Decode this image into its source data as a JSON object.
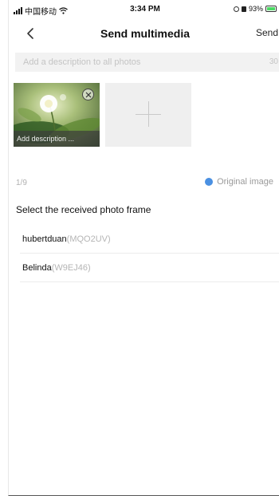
{
  "status_bar": {
    "carrier": "中国移动",
    "time": "3:34 PM",
    "battery_percent": "93%"
  },
  "nav": {
    "title": "Send multimedia",
    "send_label": "Send"
  },
  "description": {
    "placeholder": "Add a description to all photos",
    "char_limit": "30"
  },
  "photos": {
    "items": [
      {
        "caption_placeholder": "Add description ..."
      }
    ],
    "count_label": "1/9",
    "original_image_label": "Original image"
  },
  "frames": {
    "section_title": "Select the received photo frame",
    "items": [
      {
        "name": "hubertduan",
        "id": "(MQO2UV)"
      },
      {
        "name": "Belinda",
        "id": "(W9EJ46)"
      }
    ]
  },
  "colors": {
    "accent": "#4a90e2",
    "battery": "#4cd964"
  }
}
